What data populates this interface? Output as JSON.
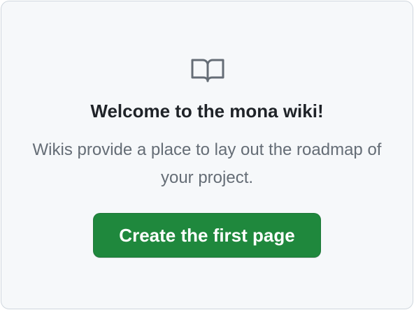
{
  "blankslate": {
    "icon": "book-icon",
    "heading": "Welcome to the mona wiki!",
    "description": "Wikis provide a place to lay out the roadmap of your project.",
    "primary_action_label": "Create the first page"
  },
  "colors": {
    "background": "#f6f8fa",
    "border": "#d0d7de",
    "heading_text": "#1f2328",
    "muted_text": "#656d76",
    "icon": "#656d76",
    "button_background": "#1f883d",
    "button_text": "#ffffff"
  }
}
